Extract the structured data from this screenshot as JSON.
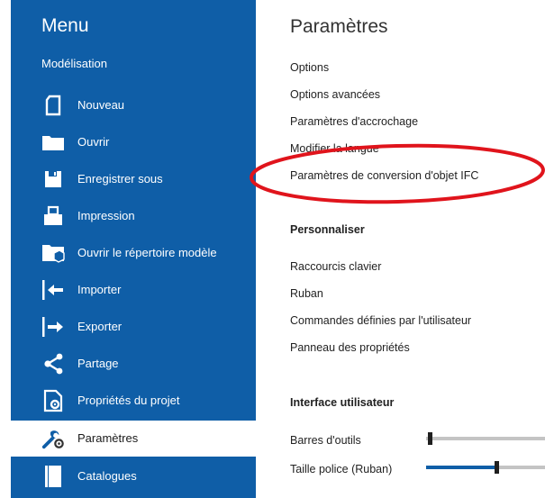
{
  "sidebar": {
    "title": "Menu",
    "section": "Modélisation",
    "items": [
      {
        "label": "Nouveau",
        "icon": "new-document-icon"
      },
      {
        "label": "Ouvrir",
        "icon": "folder-icon"
      },
      {
        "label": "Enregistrer sous",
        "icon": "save-icon"
      },
      {
        "label": "Impression",
        "icon": "printer-icon"
      },
      {
        "label": "Ouvrir le répertoire modèle",
        "icon": "model-folder-icon"
      },
      {
        "label": "Importer",
        "icon": "import-icon"
      },
      {
        "label": "Exporter",
        "icon": "export-icon"
      },
      {
        "label": "Partage",
        "icon": "share-icon"
      },
      {
        "label": "Propriétés du projet",
        "icon": "project-properties-icon"
      },
      {
        "label": "Paramètres",
        "icon": "settings-icon",
        "active": true
      },
      {
        "label": "Catalogues",
        "icon": "catalog-icon"
      }
    ]
  },
  "settings": {
    "title": "Paramètres",
    "links": [
      "Options",
      "Options avancées",
      "Paramètres d'accrochage",
      "Modifier la langue",
      "Paramètres de conversion d'objet IFC"
    ],
    "customize": {
      "heading": "Personnaliser",
      "links": [
        "Raccourcis clavier",
        "Ruban",
        "Commandes définies par l'utilisateur",
        "Panneau des propriétés"
      ]
    },
    "ui": {
      "heading": "Interface utilisateur",
      "sliders": [
        {
          "label": "Barres d'outils",
          "value": 0.0
        },
        {
          "label": "Taille police (Ruban)",
          "value": 0.6
        }
      ]
    }
  },
  "colors": {
    "sidebar": "#0f5ea7",
    "annotation": "#e0141c",
    "slider_fill": "#0f5ea7"
  }
}
